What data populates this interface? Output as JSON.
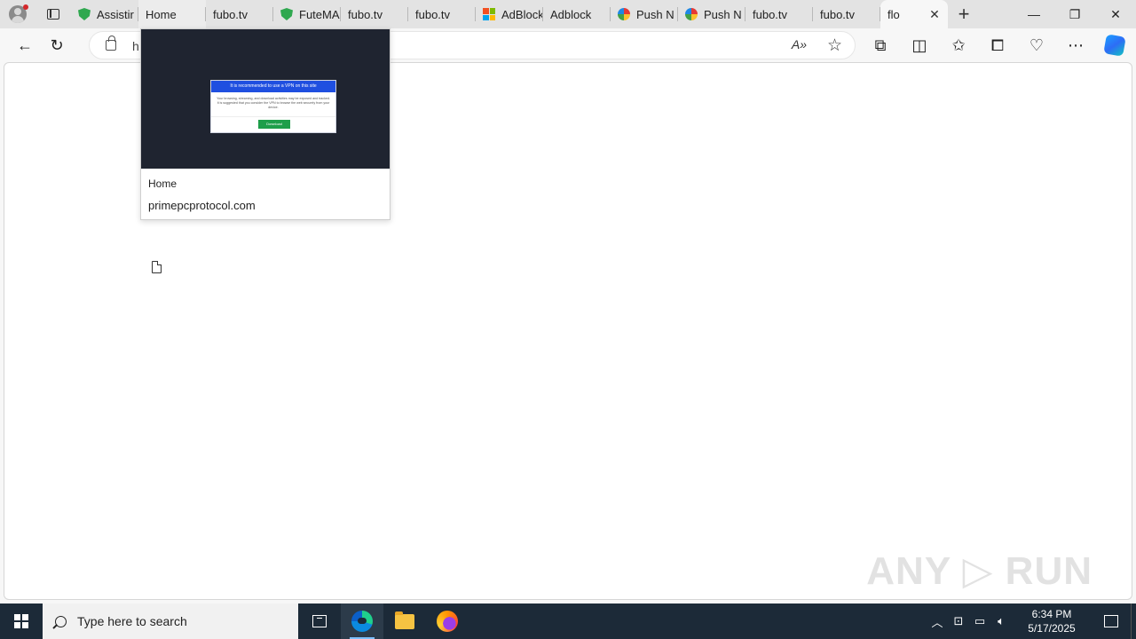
{
  "browser": {
    "tabs": [
      {
        "label": "Assistir",
        "favicon": "shield-icon"
      },
      {
        "label": "Home",
        "favicon": "page-icon"
      },
      {
        "label": "fubo.tv",
        "favicon": "page-icon"
      },
      {
        "label": "FuteMAX",
        "favicon": "shield-icon"
      },
      {
        "label": "fubo.tv",
        "favicon": "page-icon"
      },
      {
        "label": "fubo.tv",
        "favicon": "page-icon"
      },
      {
        "label": "AdBlock",
        "favicon": "microsoft-icon"
      },
      {
        "label": "Adblock",
        "favicon": "page-icon"
      },
      {
        "label": "Push N",
        "favicon": "rainbow-icon"
      },
      {
        "label": "Push N",
        "favicon": "rainbow-icon"
      },
      {
        "label": "fubo.tv",
        "favicon": "page-icon"
      },
      {
        "label": "fubo.tv",
        "favicon": "page-icon"
      },
      {
        "label": "flo",
        "favicon": "page-icon",
        "active": true
      }
    ],
    "new_tab_symbol": "+",
    "address_bar": {
      "url": "h"
    },
    "window_controls": {
      "minimize": "—",
      "restore": "❐",
      "close": "✕"
    }
  },
  "tab_preview": {
    "title": "Home",
    "site": "primepcprotocol.com",
    "thumbnail": {
      "modal_heading": "It is recommended to use a VPN on this site",
      "modal_text": "Your browsing, streaming, and download activities may be exposed and tracked. It is suggested that you consider the VPN to browse the web securely from your device.",
      "modal_button": "Download"
    }
  },
  "watermark": "ANY ▷ RUN",
  "taskbar": {
    "search_placeholder": "Type here to search",
    "clock_time": "6:34 PM",
    "clock_date": "5/17/2025"
  },
  "colors": {
    "taskbar_bg": "#1c2a38",
    "modal_header": "#1f4fe0",
    "modal_button": "#1e9e4a"
  }
}
